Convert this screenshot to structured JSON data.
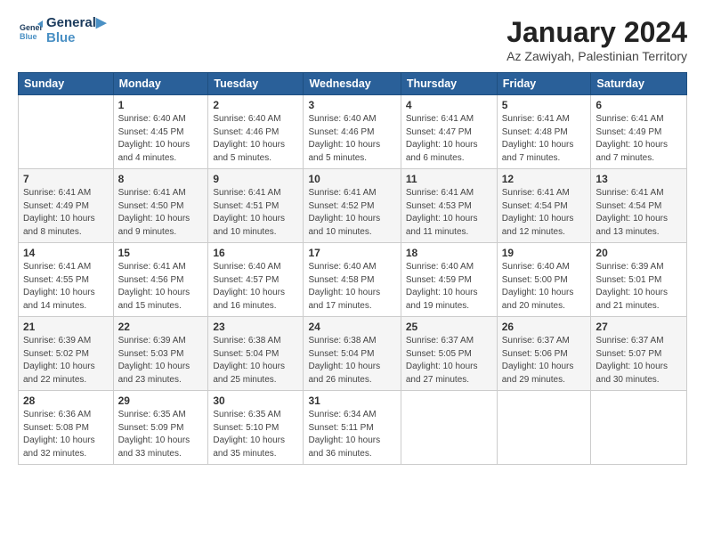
{
  "header": {
    "logo_line1": "General",
    "logo_line2": "Blue",
    "month_title": "January 2024",
    "location": "Az Zawiyah, Palestinian Territory"
  },
  "days_of_week": [
    "Sunday",
    "Monday",
    "Tuesday",
    "Wednesday",
    "Thursday",
    "Friday",
    "Saturday"
  ],
  "weeks": [
    [
      {
        "num": "",
        "info": ""
      },
      {
        "num": "1",
        "info": "Sunrise: 6:40 AM\nSunset: 4:45 PM\nDaylight: 10 hours\nand 4 minutes."
      },
      {
        "num": "2",
        "info": "Sunrise: 6:40 AM\nSunset: 4:46 PM\nDaylight: 10 hours\nand 5 minutes."
      },
      {
        "num": "3",
        "info": "Sunrise: 6:40 AM\nSunset: 4:46 PM\nDaylight: 10 hours\nand 5 minutes."
      },
      {
        "num": "4",
        "info": "Sunrise: 6:41 AM\nSunset: 4:47 PM\nDaylight: 10 hours\nand 6 minutes."
      },
      {
        "num": "5",
        "info": "Sunrise: 6:41 AM\nSunset: 4:48 PM\nDaylight: 10 hours\nand 7 minutes."
      },
      {
        "num": "6",
        "info": "Sunrise: 6:41 AM\nSunset: 4:49 PM\nDaylight: 10 hours\nand 7 minutes."
      }
    ],
    [
      {
        "num": "7",
        "info": "Sunrise: 6:41 AM\nSunset: 4:49 PM\nDaylight: 10 hours\nand 8 minutes."
      },
      {
        "num": "8",
        "info": "Sunrise: 6:41 AM\nSunset: 4:50 PM\nDaylight: 10 hours\nand 9 minutes."
      },
      {
        "num": "9",
        "info": "Sunrise: 6:41 AM\nSunset: 4:51 PM\nDaylight: 10 hours\nand 10 minutes."
      },
      {
        "num": "10",
        "info": "Sunrise: 6:41 AM\nSunset: 4:52 PM\nDaylight: 10 hours\nand 10 minutes."
      },
      {
        "num": "11",
        "info": "Sunrise: 6:41 AM\nSunset: 4:53 PM\nDaylight: 10 hours\nand 11 minutes."
      },
      {
        "num": "12",
        "info": "Sunrise: 6:41 AM\nSunset: 4:54 PM\nDaylight: 10 hours\nand 12 minutes."
      },
      {
        "num": "13",
        "info": "Sunrise: 6:41 AM\nSunset: 4:54 PM\nDaylight: 10 hours\nand 13 minutes."
      }
    ],
    [
      {
        "num": "14",
        "info": "Sunrise: 6:41 AM\nSunset: 4:55 PM\nDaylight: 10 hours\nand 14 minutes."
      },
      {
        "num": "15",
        "info": "Sunrise: 6:41 AM\nSunset: 4:56 PM\nDaylight: 10 hours\nand 15 minutes."
      },
      {
        "num": "16",
        "info": "Sunrise: 6:40 AM\nSunset: 4:57 PM\nDaylight: 10 hours\nand 16 minutes."
      },
      {
        "num": "17",
        "info": "Sunrise: 6:40 AM\nSunset: 4:58 PM\nDaylight: 10 hours\nand 17 minutes."
      },
      {
        "num": "18",
        "info": "Sunrise: 6:40 AM\nSunset: 4:59 PM\nDaylight: 10 hours\nand 19 minutes."
      },
      {
        "num": "19",
        "info": "Sunrise: 6:40 AM\nSunset: 5:00 PM\nDaylight: 10 hours\nand 20 minutes."
      },
      {
        "num": "20",
        "info": "Sunrise: 6:39 AM\nSunset: 5:01 PM\nDaylight: 10 hours\nand 21 minutes."
      }
    ],
    [
      {
        "num": "21",
        "info": "Sunrise: 6:39 AM\nSunset: 5:02 PM\nDaylight: 10 hours\nand 22 minutes."
      },
      {
        "num": "22",
        "info": "Sunrise: 6:39 AM\nSunset: 5:03 PM\nDaylight: 10 hours\nand 23 minutes."
      },
      {
        "num": "23",
        "info": "Sunrise: 6:38 AM\nSunset: 5:04 PM\nDaylight: 10 hours\nand 25 minutes."
      },
      {
        "num": "24",
        "info": "Sunrise: 6:38 AM\nSunset: 5:04 PM\nDaylight: 10 hours\nand 26 minutes."
      },
      {
        "num": "25",
        "info": "Sunrise: 6:37 AM\nSunset: 5:05 PM\nDaylight: 10 hours\nand 27 minutes."
      },
      {
        "num": "26",
        "info": "Sunrise: 6:37 AM\nSunset: 5:06 PM\nDaylight: 10 hours\nand 29 minutes."
      },
      {
        "num": "27",
        "info": "Sunrise: 6:37 AM\nSunset: 5:07 PM\nDaylight: 10 hours\nand 30 minutes."
      }
    ],
    [
      {
        "num": "28",
        "info": "Sunrise: 6:36 AM\nSunset: 5:08 PM\nDaylight: 10 hours\nand 32 minutes."
      },
      {
        "num": "29",
        "info": "Sunrise: 6:35 AM\nSunset: 5:09 PM\nDaylight: 10 hours\nand 33 minutes."
      },
      {
        "num": "30",
        "info": "Sunrise: 6:35 AM\nSunset: 5:10 PM\nDaylight: 10 hours\nand 35 minutes."
      },
      {
        "num": "31",
        "info": "Sunrise: 6:34 AM\nSunset: 5:11 PM\nDaylight: 10 hours\nand 36 minutes."
      },
      {
        "num": "",
        "info": ""
      },
      {
        "num": "",
        "info": ""
      },
      {
        "num": "",
        "info": ""
      }
    ]
  ]
}
